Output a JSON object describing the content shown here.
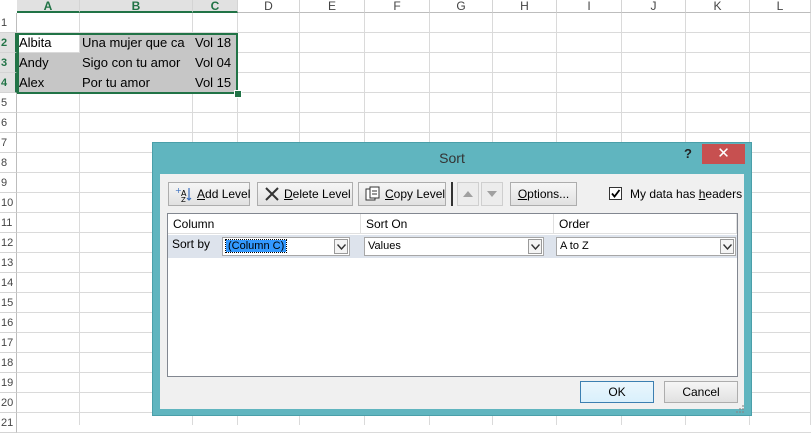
{
  "sheet": {
    "columns": [
      "A",
      "B",
      "C",
      "D",
      "E",
      "F",
      "G",
      "H",
      "I",
      "J",
      "K",
      "L"
    ],
    "rows": [
      "1",
      "2",
      "3",
      "4",
      "5",
      "6",
      "7",
      "8",
      "9",
      "10",
      "11",
      "12",
      "13",
      "14",
      "15",
      "16",
      "17",
      "18",
      "19",
      "20",
      "21"
    ],
    "cells": [
      [
        "Albita",
        "Una mujer que ca",
        "Vol 18"
      ],
      [
        "Andy",
        " Sigo con tu amor",
        "Vol 04"
      ],
      [
        "Alex",
        "Por tu amor",
        "Vol 15"
      ]
    ]
  },
  "dialog": {
    "title": "Sort",
    "help_label": "?",
    "close_label": "✕",
    "toolbar": {
      "add_level": [
        "A",
        "dd Level"
      ],
      "delete_level": [
        "D",
        "elete Level"
      ],
      "copy_level": [
        "C",
        "opy Level"
      ],
      "options": [
        "O",
        "ptions..."
      ]
    },
    "headers_checkbox": {
      "label_pre": "My data has ",
      "label_ul": "h",
      "label_post": "eaders",
      "checked": true
    },
    "grid": {
      "headers": [
        "Column",
        "Sort On",
        "Order"
      ],
      "row_label": "Sort by",
      "column_value": "(Column C)",
      "sort_on_value": "Values",
      "order_value": "A to Z"
    },
    "ok_label": "OK",
    "cancel_label": "Cancel"
  },
  "colors": {
    "excel_green": "#217346",
    "dialog_frame": "#60b5bf",
    "close_red": "#c75050",
    "selection_blue": "#3399ff"
  }
}
